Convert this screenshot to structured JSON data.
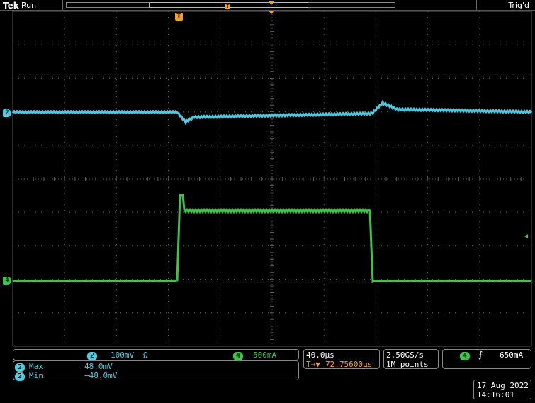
{
  "header": {
    "brand": "Tek",
    "run_status": "Run",
    "trigger_status": "Trig'd"
  },
  "markers": {
    "trigger_marker": "T",
    "ch2": "2",
    "ch4": "4"
  },
  "channels": {
    "ch2": {
      "number": "2",
      "scale": "100mV",
      "coupling_symbol": "Ω",
      "color": "#4fc8e0"
    },
    "ch4": {
      "number": "4",
      "scale": "500mA",
      "color": "#3fc24a"
    }
  },
  "measurements": [
    {
      "channel": "2",
      "label": "Max",
      "value": "48.0mV"
    },
    {
      "channel": "2",
      "label": "Min",
      "value": "−48.0mV"
    }
  ],
  "timebase": {
    "scale": "40.0µs",
    "trigger_position": "72.75600µs",
    "trigger_prefix": "T→▼"
  },
  "acquisition": {
    "sample_rate": "2.50GS/s",
    "record_length": "1M points"
  },
  "trigger": {
    "source": "4",
    "slope_symbol": "⨍",
    "level": "650mA"
  },
  "datetime": {
    "date": "17 Aug 2022",
    "time": "14:16:01"
  },
  "colors": {
    "ch2": "#4fc8e0",
    "ch4": "#3fc24a",
    "trigger": "#f0a030",
    "grid": "#5a5a5a"
  }
}
